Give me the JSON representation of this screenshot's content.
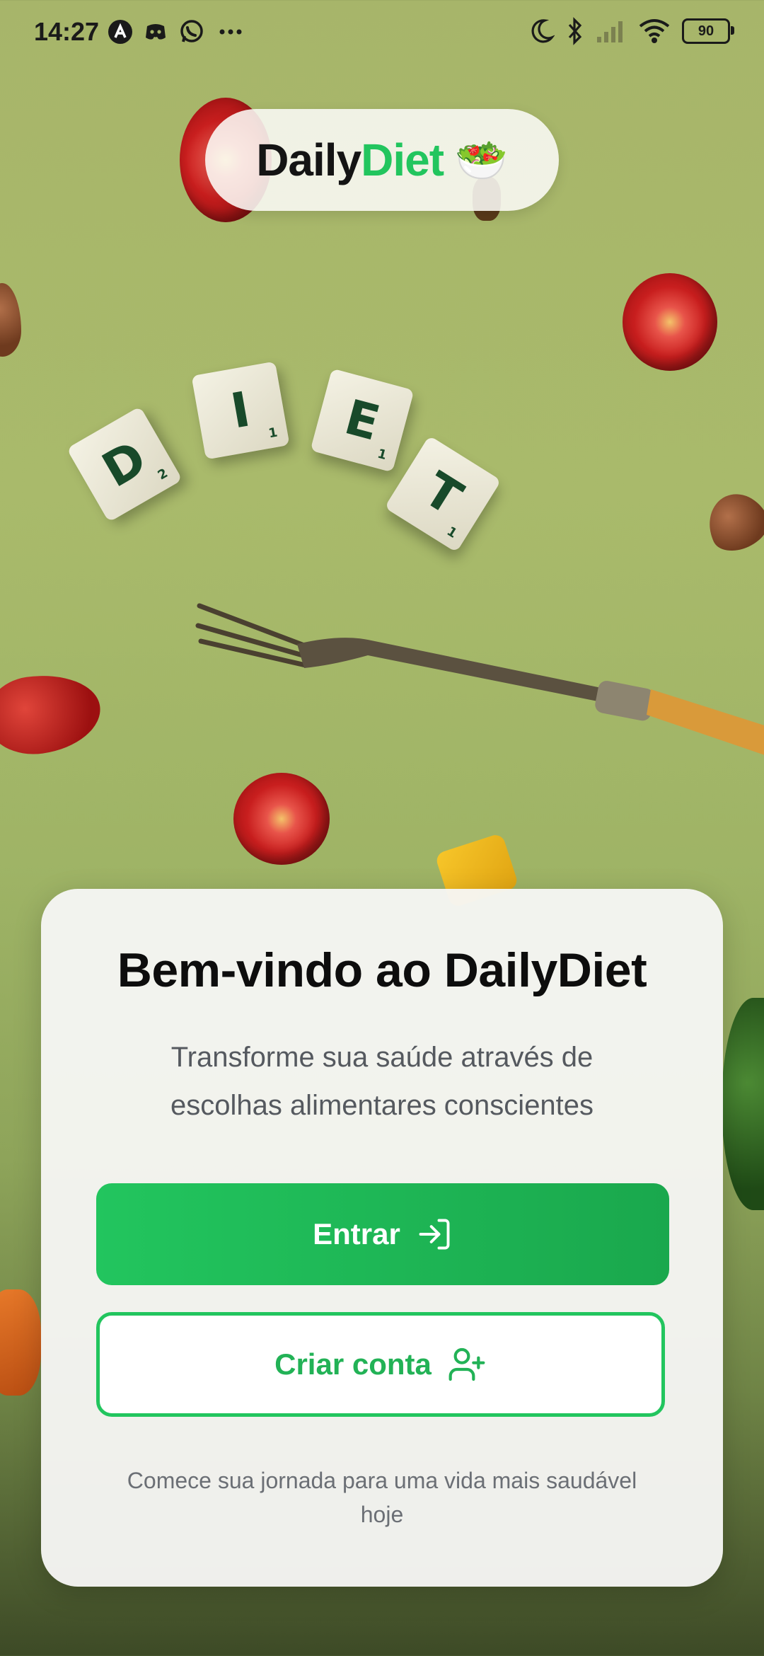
{
  "status_bar": {
    "time": "14:27",
    "left_icons": [
      "a-circle-icon",
      "discord-icon",
      "whatsapp-icon",
      "more-icon"
    ],
    "right_icons": [
      "moon-icon",
      "bluetooth-icon",
      "signal-icon",
      "wifi-icon"
    ],
    "battery": "90"
  },
  "header": {
    "brand_part1": "Daily",
    "brand_part2": "Diet",
    "brand_emoji": "🥗"
  },
  "background_tiles": [
    {
      "letter": "D",
      "points": "2"
    },
    {
      "letter": "I",
      "points": "1"
    },
    {
      "letter": "E",
      "points": "1"
    },
    {
      "letter": "T",
      "points": "1"
    }
  ],
  "welcome_card": {
    "title": "Bem-vindo ao DailyDiet",
    "subtitle": "Transforme sua saúde através de escolhas alimentares conscientes",
    "login_button": "Entrar",
    "login_icon": "log-in-icon",
    "signup_button": "Criar conta",
    "signup_icon": "user-plus-icon",
    "footer": "Comece sua jornada para uma vida mais saudável hoje"
  },
  "colors": {
    "brand_green": "#22c55e",
    "title": "#0d0d0d",
    "subtitle": "#55595f"
  }
}
